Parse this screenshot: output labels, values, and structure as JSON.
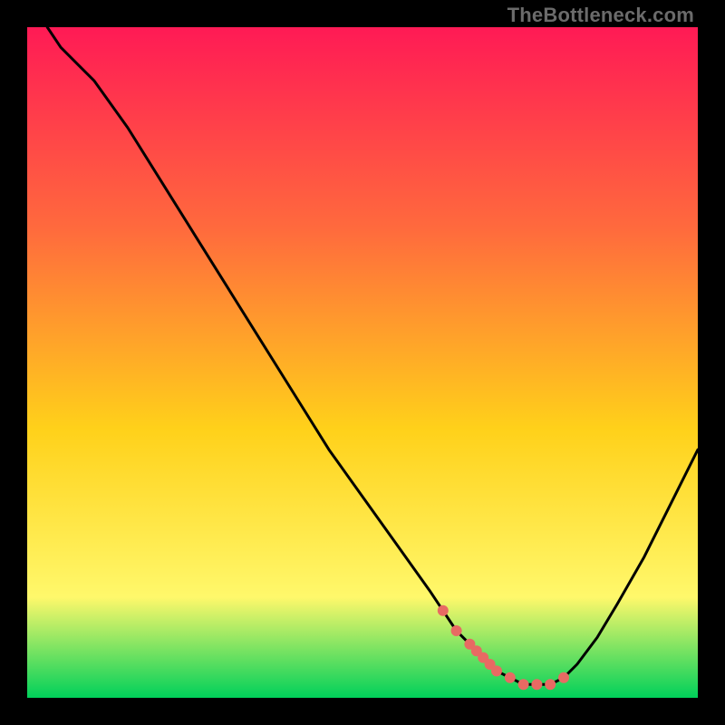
{
  "watermark": "TheBottleneck.com",
  "colors": {
    "gradient_top": "#ff1a55",
    "gradient_mid1": "#ff6a3d",
    "gradient_mid2": "#ffd11a",
    "gradient_mid3": "#fff86b",
    "gradient_bottom": "#00d05a",
    "curve": "#000000",
    "marker": "#e86a63",
    "frame": "#000000"
  },
  "chart_data": {
    "type": "line",
    "title": "",
    "xlabel": "",
    "ylabel": "",
    "xlim": [
      0,
      100
    ],
    "ylim": [
      0,
      100
    ],
    "x": [
      3,
      5,
      8,
      10,
      15,
      20,
      25,
      30,
      35,
      40,
      45,
      50,
      55,
      60,
      62,
      64,
      66,
      68,
      70,
      72,
      74,
      76,
      78,
      80,
      82,
      85,
      88,
      92,
      96,
      100
    ],
    "values": [
      100,
      97,
      94,
      92,
      85,
      77,
      69,
      61,
      53,
      45,
      37,
      30,
      23,
      16,
      13,
      10,
      8,
      6,
      4,
      3,
      2,
      2,
      2,
      3,
      5,
      9,
      14,
      21,
      29,
      37
    ],
    "markers": {
      "x": [
        62,
        64,
        66,
        67,
        68,
        69,
        70,
        72,
        74,
        76,
        78,
        80
      ],
      "y": [
        13,
        10,
        8,
        7,
        6,
        5,
        4,
        3,
        2,
        2,
        2,
        3
      ]
    }
  }
}
